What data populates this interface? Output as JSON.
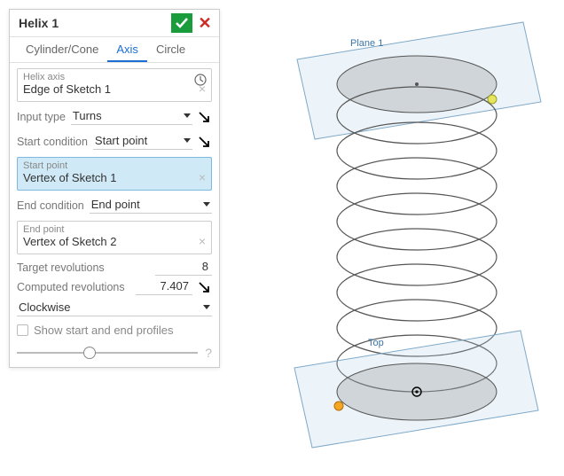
{
  "panel": {
    "title": "Helix 1",
    "tabs": [
      "Cylinder/Cone",
      "Axis",
      "Circle"
    ],
    "active_tab": 1,
    "helix_axis": {
      "label": "Helix axis",
      "value": "Edge of Sketch 1"
    },
    "input_type": {
      "label": "Input type",
      "value": "Turns"
    },
    "start_condition": {
      "label": "Start condition",
      "value": "Start point"
    },
    "start_point": {
      "label": "Start point",
      "value": "Vertex of Sketch 1"
    },
    "end_condition": {
      "label": "End condition",
      "value": "End point"
    },
    "end_point": {
      "label": "End point",
      "value": "Vertex of Sketch 2"
    },
    "target_rev": {
      "label": "Target revolutions",
      "value": "8"
    },
    "computed_rev": {
      "label": "Computed revolutions",
      "value": "7.407"
    },
    "direction": {
      "value": "Clockwise"
    },
    "show_profiles": {
      "label": "Show start and end profiles",
      "checked": false
    }
  },
  "viewport": {
    "plane_top_label": "Plane 1",
    "plane_bottom_label": "Top"
  }
}
